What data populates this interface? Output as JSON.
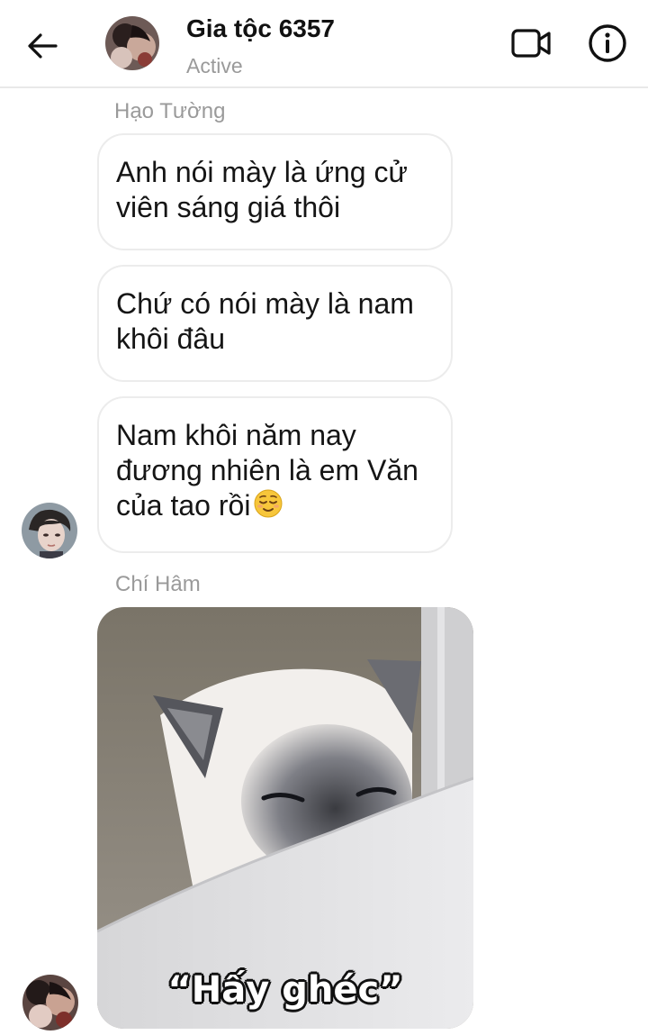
{
  "header": {
    "title": "Gia tộc 6357",
    "status": "Active",
    "icons": {
      "back": "back-arrow-icon",
      "video": "video-call-icon",
      "info": "info-icon"
    }
  },
  "messages": [
    {
      "sender": "Hạo Tường",
      "text": "Anh nói mày là ứng cử viên sáng giá thôi"
    },
    {
      "text": "Chứ có nói mày là nam khôi đâu"
    },
    {
      "text": "Nam khôi năm nay đương nhiên là em Văn của tao rồi",
      "emoji": "relieved-face-emoji"
    },
    {
      "sender": "Chí Hâm",
      "image": "cat-meme-image",
      "caption": "“Hấy ghéc”"
    }
  ],
  "colors": {
    "bubble_border": "#ececec",
    "meta_text": "#9a9a9a",
    "text": "#151515"
  }
}
